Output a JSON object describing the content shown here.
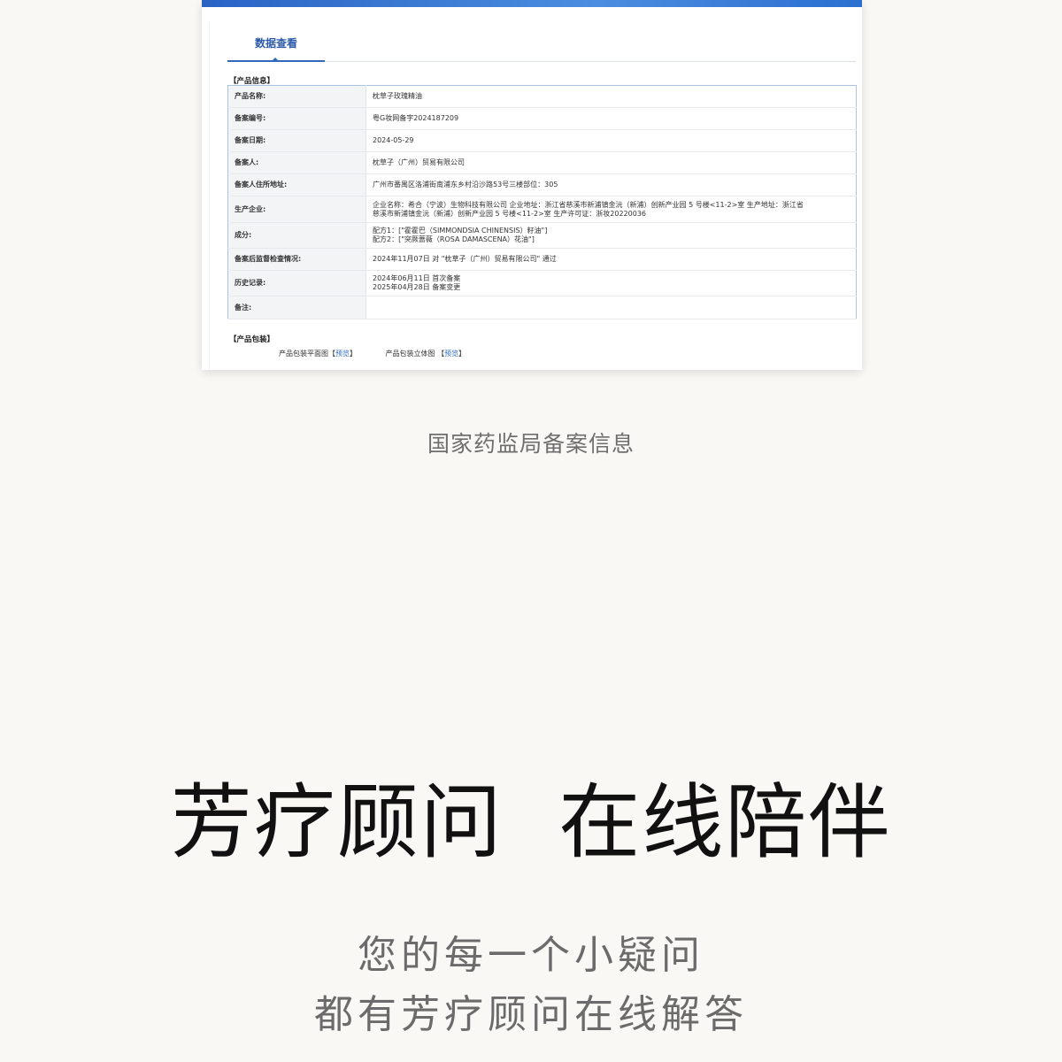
{
  "screenshot": {
    "tab_label": "数据查看",
    "section_product_info": "【产品信息】",
    "rows": [
      {
        "label": "产品名称:",
        "value": "枕草子玫瑰精油"
      },
      {
        "label": "备案编号:",
        "value": "粤G妆网备字2024187209"
      },
      {
        "label": "备案日期:",
        "value": "2024-05-29"
      },
      {
        "label": "备案人:",
        "value": "枕草子（广州）贸易有限公司"
      },
      {
        "label": "备案人住所地址:",
        "value": "广州市番禺区洛浦街南浦东乡村沿沙路53号三楼部位：305"
      },
      {
        "label": "生产企业:",
        "value": "企业名称：希合（宁波）生物科技有限公司 企业地址：浙江省慈溪市新浦镇金沅（新浦）创新产业园 5 号楼<11-2>室 生产地址：浙江省\n慈溪市新浦镇金沅（新浦）创新产业园 5 号楼<11-2>室 生产许可证：浙妆20220036"
      },
      {
        "label": "成分:",
        "value": "配方1：[\"霍霍巴（SIMMONDSIA CHINENSIS）籽油\"]\n配方2：[\"突厥蔷薇（ROSA DAMASCENA）花油\"]"
      },
      {
        "label": "备案后监督检查情况:",
        "value": "2024年11月07日 对 \"枕草子（广州）贸易有限公司\" 通过"
      },
      {
        "label": "历史记录:",
        "value": "2024年06月11日 首次备案\n2025年04月28日 备案变更"
      },
      {
        "label": "备注:",
        "value": ""
      }
    ],
    "section_packaging": "【产品包装】",
    "packaging": [
      {
        "label": "产品包装平面图",
        "link": "预览"
      },
      {
        "label": "产品包装立体图",
        "link": "预览"
      }
    ]
  },
  "caption": "国家药监局备案信息",
  "headline": "芳疗顾问  在线陪伴",
  "subline_1": "您的每一个小疑问",
  "subline_2": "都有芳疗顾问在线解答",
  "colors": {
    "background": "#f9f8f4",
    "accent_blue": "#2f69bd",
    "headline": "#111111",
    "subtext": "#6b6b6b"
  }
}
